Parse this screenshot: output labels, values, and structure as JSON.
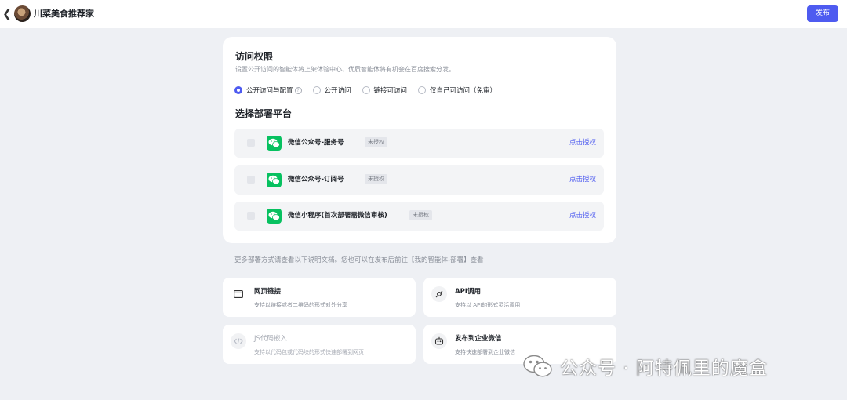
{
  "header": {
    "back_icon": "chevron-left-icon",
    "title": "川菜美食推荐家",
    "publish_label": "发布",
    "accent": "#4e5bf0"
  },
  "access": {
    "title": "访问权限",
    "description": "设置公开访问的智能体将上架体验中心、优质智能体将有机会在百度搜索分发。",
    "options": [
      {
        "label": "公开访问与配置",
        "selected": true,
        "help": "?"
      },
      {
        "label": "公开访问",
        "selected": false
      },
      {
        "label": "链接可访问",
        "selected": false
      },
      {
        "label": "仅自己可访问（免审）",
        "selected": false
      }
    ]
  },
  "platforms": {
    "title": "选择部署平台",
    "items": [
      {
        "name": "微信公众号-服务号",
        "badge": "未授权",
        "action": "点击授权",
        "icon": "wechat-icon"
      },
      {
        "name": "微信公众号-订阅号",
        "badge": "未授权",
        "action": "点击授权",
        "icon": "wechat-icon"
      },
      {
        "name": "微信小程序(首次部署需微信审核)",
        "badge": "未授权",
        "action": "点击授权",
        "icon": "wechat-icon"
      }
    ]
  },
  "more_text": "更多部署方式请查看以下说明文档。您也可以在发布后前往【我的智能体-部署】查看",
  "deploy_options": [
    {
      "title": "网页链接",
      "subtitle": "支持以链接或者二维码的形式对外分享",
      "icon": "browser-window-icon",
      "disabled": false
    },
    {
      "title": "API调用",
      "subtitle": "支持以 API的形式灵活调用",
      "icon": "api-plug-icon",
      "disabled": false
    },
    {
      "title": "JS代码嵌入",
      "subtitle": "支持以代码包或代码块的形式快速部署到网页",
      "icon": "code-icon",
      "disabled": true
    },
    {
      "title": "发布到企业微信",
      "subtitle": "支持快速部署到企业微信",
      "icon": "robot-icon",
      "disabled": false
    }
  ],
  "watermark": {
    "text": "公众号 · 阿特佩里的魔盒",
    "icon": "wechat-logo-icon"
  }
}
